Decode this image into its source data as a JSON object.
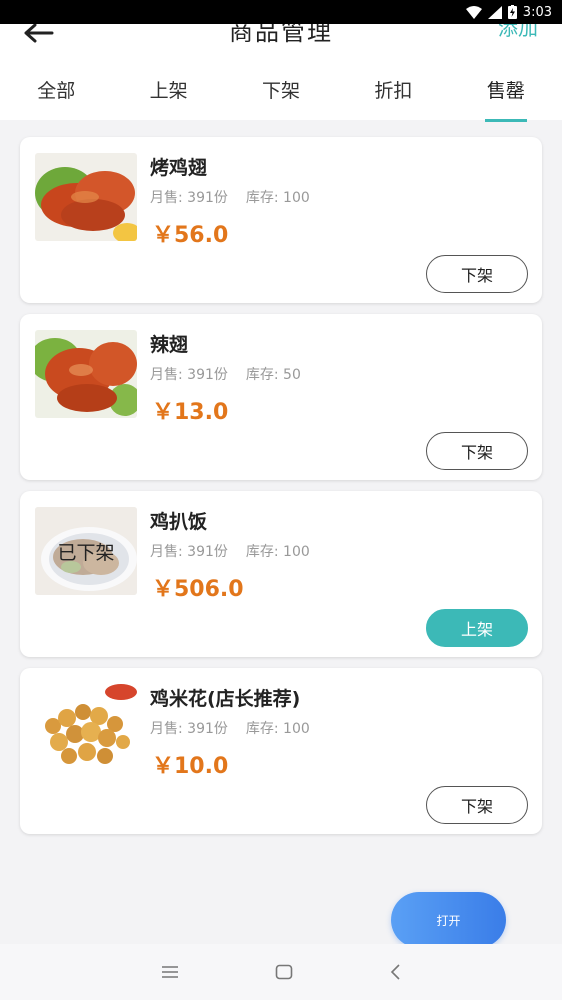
{
  "status_bar": {
    "time": "3:03"
  },
  "header": {
    "title": "商品管理",
    "add_label": "添加"
  },
  "tabs": [
    {
      "label": "全部",
      "active": false
    },
    {
      "label": "上架",
      "active": false
    },
    {
      "label": "下架",
      "active": false
    },
    {
      "label": "折扣",
      "active": false
    },
    {
      "label": "售罄",
      "active": true
    }
  ],
  "products": [
    {
      "name": "烤鸡翅",
      "sales": "月售: 391份",
      "stock": "库存: 100",
      "price": "￥56.0",
      "button": "下架",
      "overlay": ""
    },
    {
      "name": "辣翅",
      "sales": "月售: 391份",
      "stock": "库存: 50",
      "price": "￥13.0",
      "button": "下架",
      "overlay": ""
    },
    {
      "name": "鸡扒饭",
      "sales": "月售: 391份",
      "stock": "库存: 100",
      "price": "￥506.0",
      "button": "上架",
      "overlay": "已下架"
    },
    {
      "name": "鸡米花(店长推荐)",
      "sales": "月售: 391份",
      "stock": "库存: 100",
      "price": "￥10.0",
      "button": "下架",
      "overlay": ""
    }
  ],
  "fab": {
    "label": "打开"
  },
  "colors": {
    "accent": "#3cb9b7",
    "price": "#e2761b",
    "fab": "#3a7de8"
  }
}
